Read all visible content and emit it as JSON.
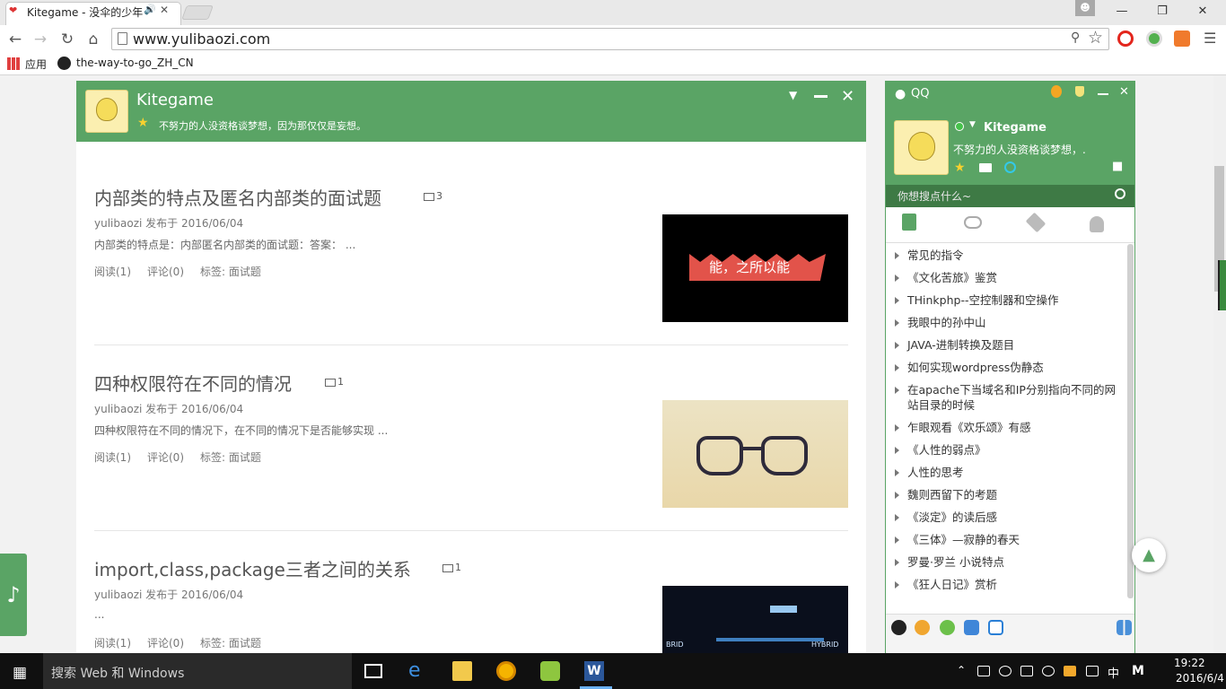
{
  "browser": {
    "tab_title": "Kitegame - 没伞的少年",
    "url": "www.yulibaozi.com",
    "bookmarks": {
      "apps": "应用",
      "github": "the-way-to-go_ZH_CN"
    }
  },
  "header": {
    "name": "Kitegame",
    "motto": "不努力的人没资格谈梦想，因为那仅仅是妄想。"
  },
  "posts": [
    {
      "title": "内部类的特点及匿名内部类的面试题",
      "images": "3",
      "meta": "yulibaozi 发布于 2016/06/04",
      "excerpt": "内部类的特点是：内部匿名内部类的面试题：答案： ...",
      "reads": "阅读(1)",
      "comments": "评论(0)",
      "tags": "标签: 面试题",
      "thumb_text": "能，之所以能"
    },
    {
      "title": "四种权限符在不同的情况",
      "images": "1",
      "meta": "yulibaozi 发布于 2016/06/04",
      "excerpt": "四种权限符在不同的情况下，在不同的情况下是否能够实现 ...",
      "reads": "阅读(1)",
      "comments": "评论(0)",
      "tags": "标签: 面试题"
    },
    {
      "title": "import,class,package三者之间的关系",
      "images": "1",
      "meta": "yulibaozi 发布于 2016/06/04",
      "excerpt": "...",
      "reads": "阅读(1)",
      "comments": "评论(0)",
      "tags": "标签: 面试题",
      "thumb_text_left": "BRID",
      "thumb_text_right": "HYBRID"
    }
  ],
  "qq": {
    "label": "QQ",
    "name": "Kitegame",
    "signature": "不努力的人没资格谈梦想，.",
    "search_placeholder": "你想搜点什么~",
    "items": [
      "常见的指令",
      "《文化苦旅》鉴赏",
      "THinkphp--空控制器和空操作",
      "我眼中的孙中山",
      "JAVA-进制转换及题目",
      "如何实现wordpress伪静态",
      "在apache下当域名和IP分别指向不同的网站目录的时候",
      "乍眼观看《欢乐颂》有感",
      "《人性的弱点》",
      "人性的思考",
      "魏则西留下的考题",
      "《淡定》的读后感",
      "《三体》—寂静的春天",
      "罗曼·罗兰 小说特点",
      "《狂人日记》赏析"
    ]
  },
  "taskbar": {
    "search": "搜索 Web 和 Windows",
    "ime_lang": "中",
    "ime_mode": "M",
    "time": "19:22",
    "date": "2016/6/4"
  },
  "colors": {
    "accent": "#5aa465",
    "search_bar": "#3e7a45"
  }
}
